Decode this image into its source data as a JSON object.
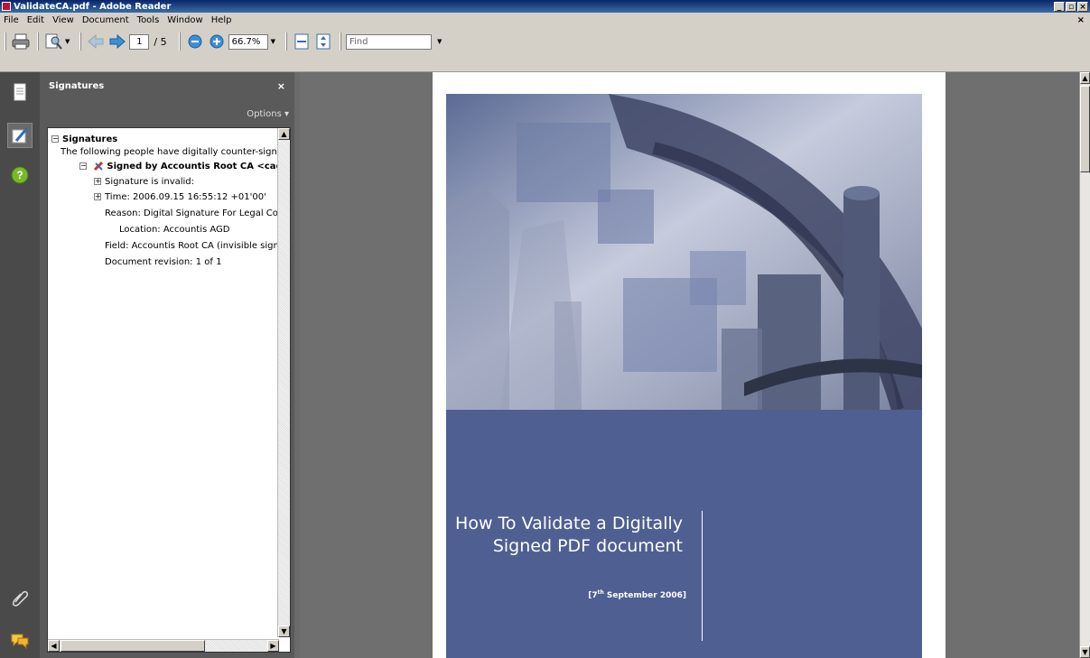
{
  "window": {
    "title": "ValidateCA.pdf - Adobe Reader",
    "min": "_",
    "max": "▫",
    "close": "×",
    "doc_close": "×"
  },
  "menu": [
    "File",
    "Edit",
    "View",
    "Document",
    "Tools",
    "Window",
    "Help"
  ],
  "toolbar": {
    "page_current": "1",
    "page_total": "/ 5",
    "zoom": "66.7%",
    "find_placeholder": "Find"
  },
  "signatures_panel": {
    "title": "Signatures",
    "close": "×",
    "options": "Options ▾",
    "tree": {
      "root": "Signatures",
      "intro": "The following people have digitally counter-signed th",
      "signer": "Signed by Accountis Root CA <ca@a",
      "status": "Signature is invalid:",
      "time": "Time: 2006.09.15 16:55:12 +01'00'",
      "reason": "Reason: Digital Signature For Legal Complia",
      "location": "Location: Accountis AGD",
      "field": "Field: Accountis Root CA (invisible signatur",
      "revision": "Document revision: 1 of 1"
    }
  },
  "document": {
    "title_line1": "How To Validate a Digitally",
    "title_line2": "Signed PDF document",
    "date_prefix": "[7",
    "date_sup": "th",
    "date_suffix": " September 2006]"
  },
  "icons": [
    "print-icon",
    "search-doc-icon",
    "prev-page-icon",
    "next-page-icon",
    "zoom-out-icon",
    "zoom-in-icon",
    "fit-width-icon",
    "fit-page-icon",
    "pages-icon",
    "signatures-icon",
    "help-icon",
    "attachment-icon",
    "comments-icon"
  ],
  "colors": {
    "cover_blue": "#4f5f91",
    "title_bar": "#0a246a",
    "panel_dark": "#4a4a4a"
  }
}
